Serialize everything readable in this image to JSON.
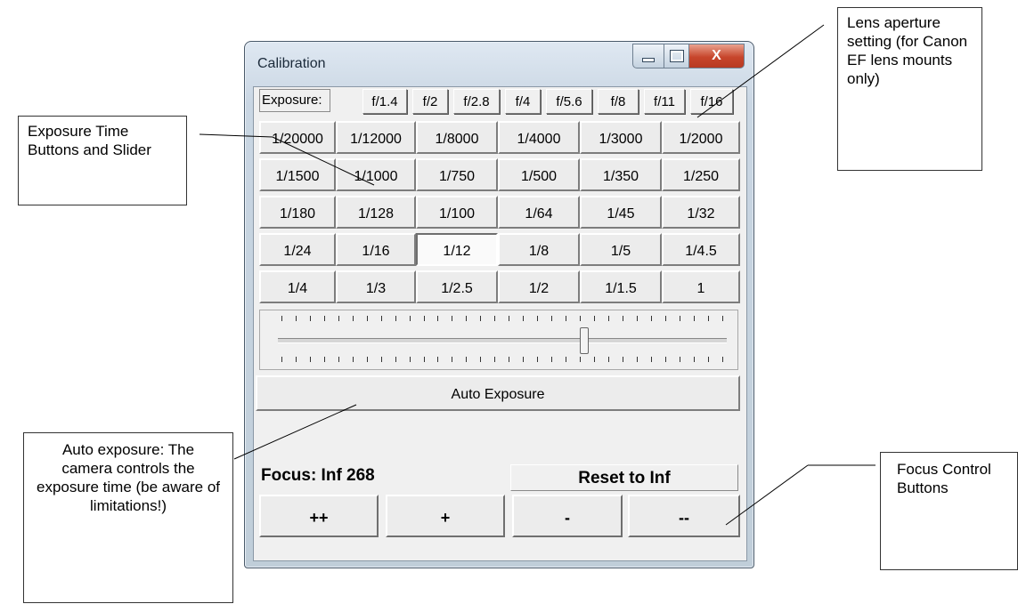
{
  "window": {
    "title": "Calibration",
    "controls": {
      "minimize": "minimize-icon",
      "maximize": "maximize-icon",
      "close": "X"
    }
  },
  "aperture": {
    "label": "Exposure:",
    "stops": [
      "f/1.4",
      "f/2",
      "f/2.8",
      "f/4",
      "f/5.6",
      "f/8",
      "f/11",
      "f/16"
    ]
  },
  "exposure_times": {
    "rows": [
      [
        "1/20000",
        "1/12000",
        "1/8000",
        "1/4000",
        "1/3000",
        "1/2000"
      ],
      [
        "1/1500",
        "1/1000",
        "1/750",
        "1/500",
        "1/350",
        "1/250"
      ],
      [
        "1/180",
        "1/128",
        "1/100",
        "1/64",
        "1/45",
        "1/32"
      ],
      [
        "1/24",
        "1/16",
        "1/12",
        "1/8",
        "1/5",
        "1/4.5"
      ],
      [
        "1/4",
        "1/3",
        "1/2.5",
        "1/2",
        "1/1.5",
        "1"
      ]
    ],
    "selected": "1/12"
  },
  "slider": {
    "tick_count": 32,
    "position_fraction": 0.68
  },
  "auto_exposure_label": "Auto Exposure",
  "focus": {
    "label": "Focus: Inf 268",
    "reset_label": "Reset to Inf",
    "buttons": [
      "++",
      "+",
      "-",
      "--"
    ]
  },
  "annotations": {
    "lens": "Lens aperture setting (for Canon EF lens mounts only)",
    "exposure": "Exposure Time Buttons and Slider",
    "auto": "Auto exposure: The camera controls the exposure time (be aware of limitations!)",
    "focus": "Focus Control Buttons"
  }
}
